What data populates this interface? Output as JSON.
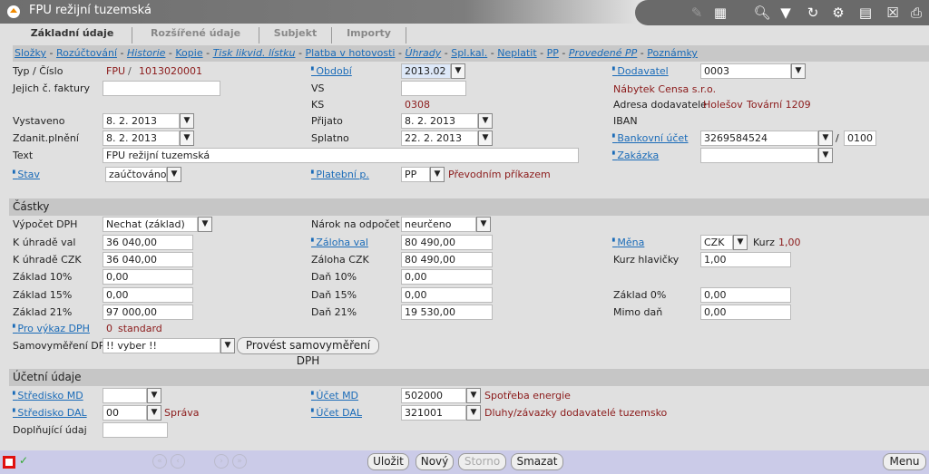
{
  "window": {
    "title": "FPU režijní tuzemská"
  },
  "toolbar": [
    "edit-icon",
    "table-icon",
    "search-icon",
    "filter-icon",
    "refresh-icon",
    "user-settings-icon",
    "document-icon",
    "excel-icon",
    "print-icon"
  ],
  "tabs": [
    "Základní údaje",
    "Rozšířené údaje",
    "Subjekt",
    "Importy"
  ],
  "links": [
    "Složky",
    "Rozúčtování",
    "Historie",
    "Kopie",
    "Tisk likvid. lístku",
    "Platba v hotovosti",
    "Úhrady",
    "Spl.kal.",
    "Neplatit",
    "PP",
    "Provedené PP",
    "Poznámky"
  ],
  "header": {
    "typ_label": "Typ / Číslo",
    "typ": "FPU",
    "slash": "/",
    "cislo": "1013020001",
    "faktura_label": "Jejich č. faktury",
    "faktura": "",
    "vystaveno_label": "Vystaveno",
    "vystaveno": "8. 2. 2013",
    "zdanit_label": "Zdanit.plnění",
    "zdanit": "8. 2. 2013",
    "text_label": "Text",
    "text": "FPU režijní tuzemská",
    "stav_label": "Stav",
    "stav": "zaúčtováno",
    "obdobi_label": "Období",
    "obdobi": "2013.02",
    "vs_label": "VS",
    "vs": "",
    "ks_label": "KS",
    "ks": "0308",
    "prijato_label": "Přijato",
    "prijato": "8. 2. 2013",
    "splatno_label": "Splatno",
    "splatno": "22. 2. 2013",
    "platebni_label": "Platební p.",
    "platebni": "PP",
    "platebni_text": "Převodním příkazem",
    "dodavatel_label": "Dodavatel",
    "dodavatel": "0003",
    "dodavatel_name": "Nábytek Censa s.r.o.",
    "adresa_label": "Adresa dodavatele",
    "adresa_city": "Holešov",
    "adresa_street": "Tovární 1209",
    "iban_label": "IBAN",
    "ucet_label": "Bankovní účet",
    "ucet": "3269584524",
    "ucet_slash": "/",
    "banka": "0100",
    "zakazka_label": "Zakázka",
    "zakazka": ""
  },
  "castky": {
    "title": "Částky",
    "vypocet_label": "Výpočet DPH",
    "vypocet": "Nechat (základ)",
    "kuhrade_val_label": "K úhradě val",
    "kuhrade_val": "36 040,00",
    "kuhrade_czk_label": "K úhradě CZK",
    "kuhrade_czk": "36 040,00",
    "zaklad10_label": "Základ 10%",
    "zaklad10": "0,00",
    "zaklad15_label": "Základ 15%",
    "zaklad15": "0,00",
    "zaklad21_label": "Základ 21%",
    "zaklad21": "97 000,00",
    "vykaz_label": "Pro výkaz DPH",
    "vykaz_code": "0",
    "vykaz_text": "standard",
    "samo_label": "Samovyměření DPH",
    "samo": "!! vyber !!",
    "samo_button": "Provést samovyměření DPH",
    "narok_label": "Nárok na odpočet",
    "narok": "neurčeno",
    "zaloha_val_label": "Záloha val",
    "zaloha_val": "80 490,00",
    "zaloha_czk_label": "Záloha CZK",
    "zaloha_czk": "80 490,00",
    "dan10_label": "Daň 10%",
    "dan10": "0,00",
    "dan15_label": "Daň 15%",
    "dan15": "0,00",
    "dan21_label": "Daň 21%",
    "dan21": "19 530,00",
    "mena_label": "Měna",
    "mena": "CZK",
    "kurz_label": "Kurz",
    "kurz": "1,00",
    "kurzh_label": "Kurz hlavičky",
    "kurzh": "1,00",
    "zaklad0_label": "Základ 0%",
    "zaklad0": "0,00",
    "mimo_label": "Mimo daň",
    "mimo": "0,00"
  },
  "ucetni": {
    "title": "Účetní údaje",
    "smd_label": "Středisko MD",
    "smd": "",
    "sdal_label": "Středisko DAL",
    "sdal": "00",
    "sdal_text": "Správa",
    "dopl_label": "Doplňující údaj",
    "dopl": "",
    "umd_label": "Účet MD",
    "umd": "502000",
    "umd_text": "Spotřeba energie",
    "udal_label": "Účet DAL",
    "udal": "321001",
    "udal_text": "Dluhy/závazky dodavatelé tuzemsko"
  },
  "bottom": {
    "ulozit": "Uložit",
    "novy": "Nový",
    "storno": "Storno",
    "smazat": "Smazat",
    "menu": "Menu"
  },
  "colors": {
    "link": "#1a6bb8",
    "value": "#8b1a1a",
    "bottom_bar": "#cbcbe8"
  }
}
